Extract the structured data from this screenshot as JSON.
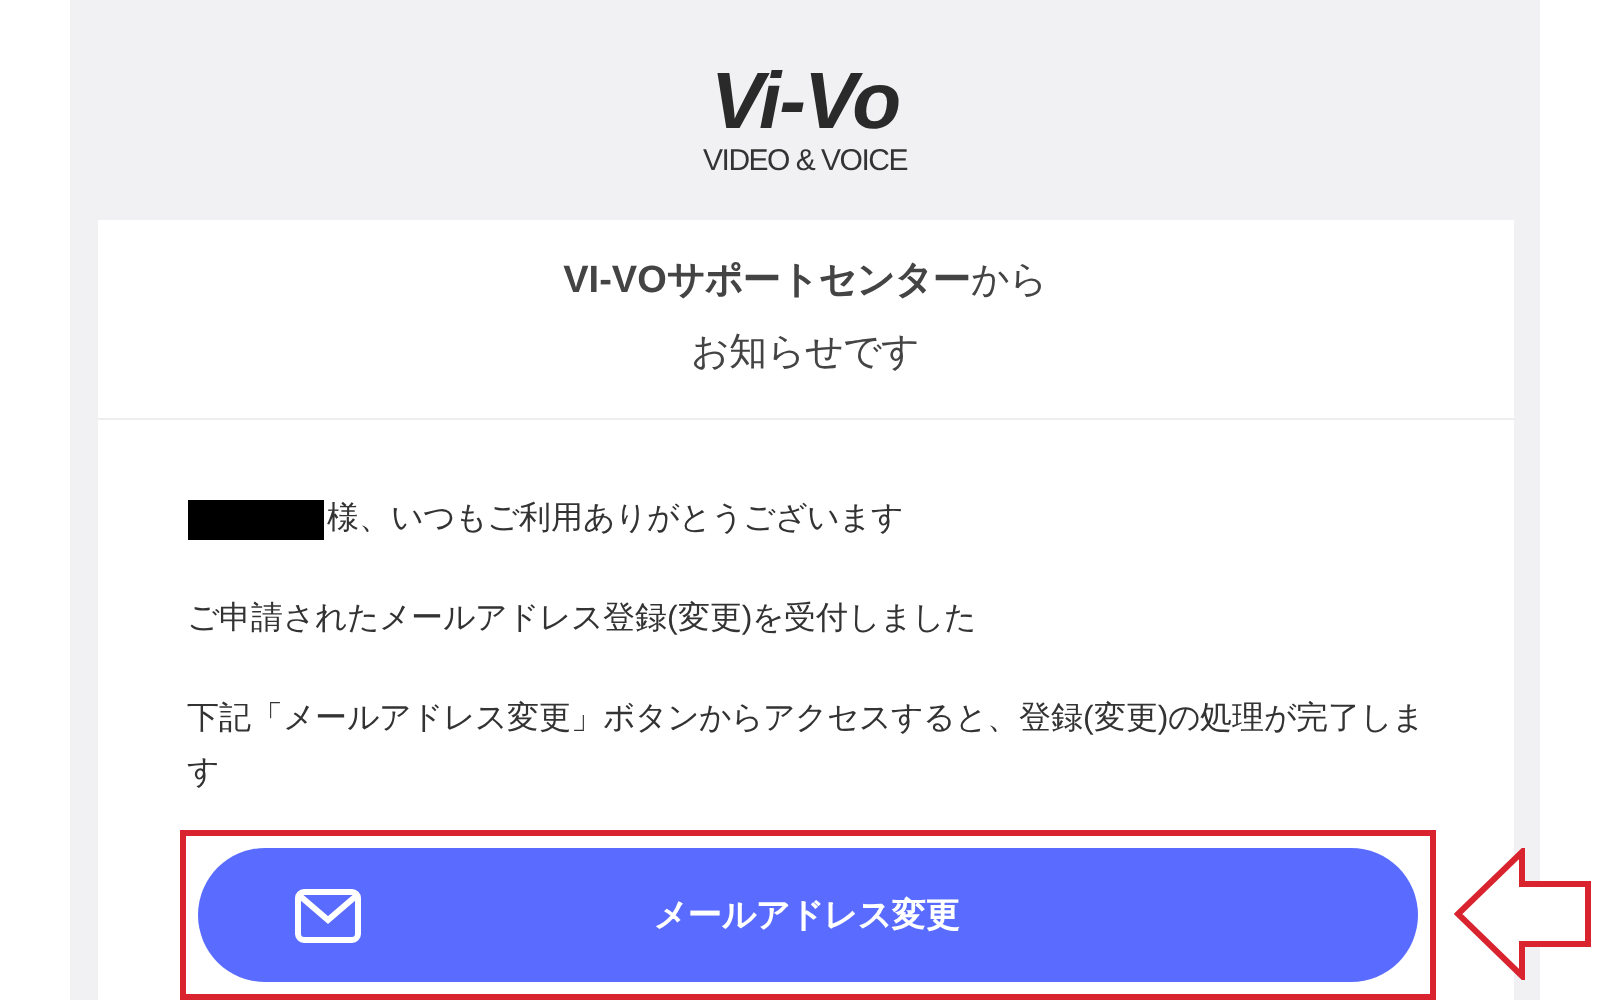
{
  "logo": {
    "wordmark": "Vi-Vo",
    "tagline": "VIDEO & VOICE"
  },
  "heading": [
    "**VI-VOサポートセンター**から",
    "お知らせです"
  ],
  "greeting": {
    "name_redacted": true,
    "text": "様、いつもご利用ありがとうございます"
  },
  "paragraphs": [
    "ご申請されたメールアドレス登録(変更)を受付しました",
    "下記「メールアドレス変更」ボタンからアクセスすると、登録(変更)の処理が完了します"
  ],
  "button": {
    "label": "メールアドレス変更"
  }
}
